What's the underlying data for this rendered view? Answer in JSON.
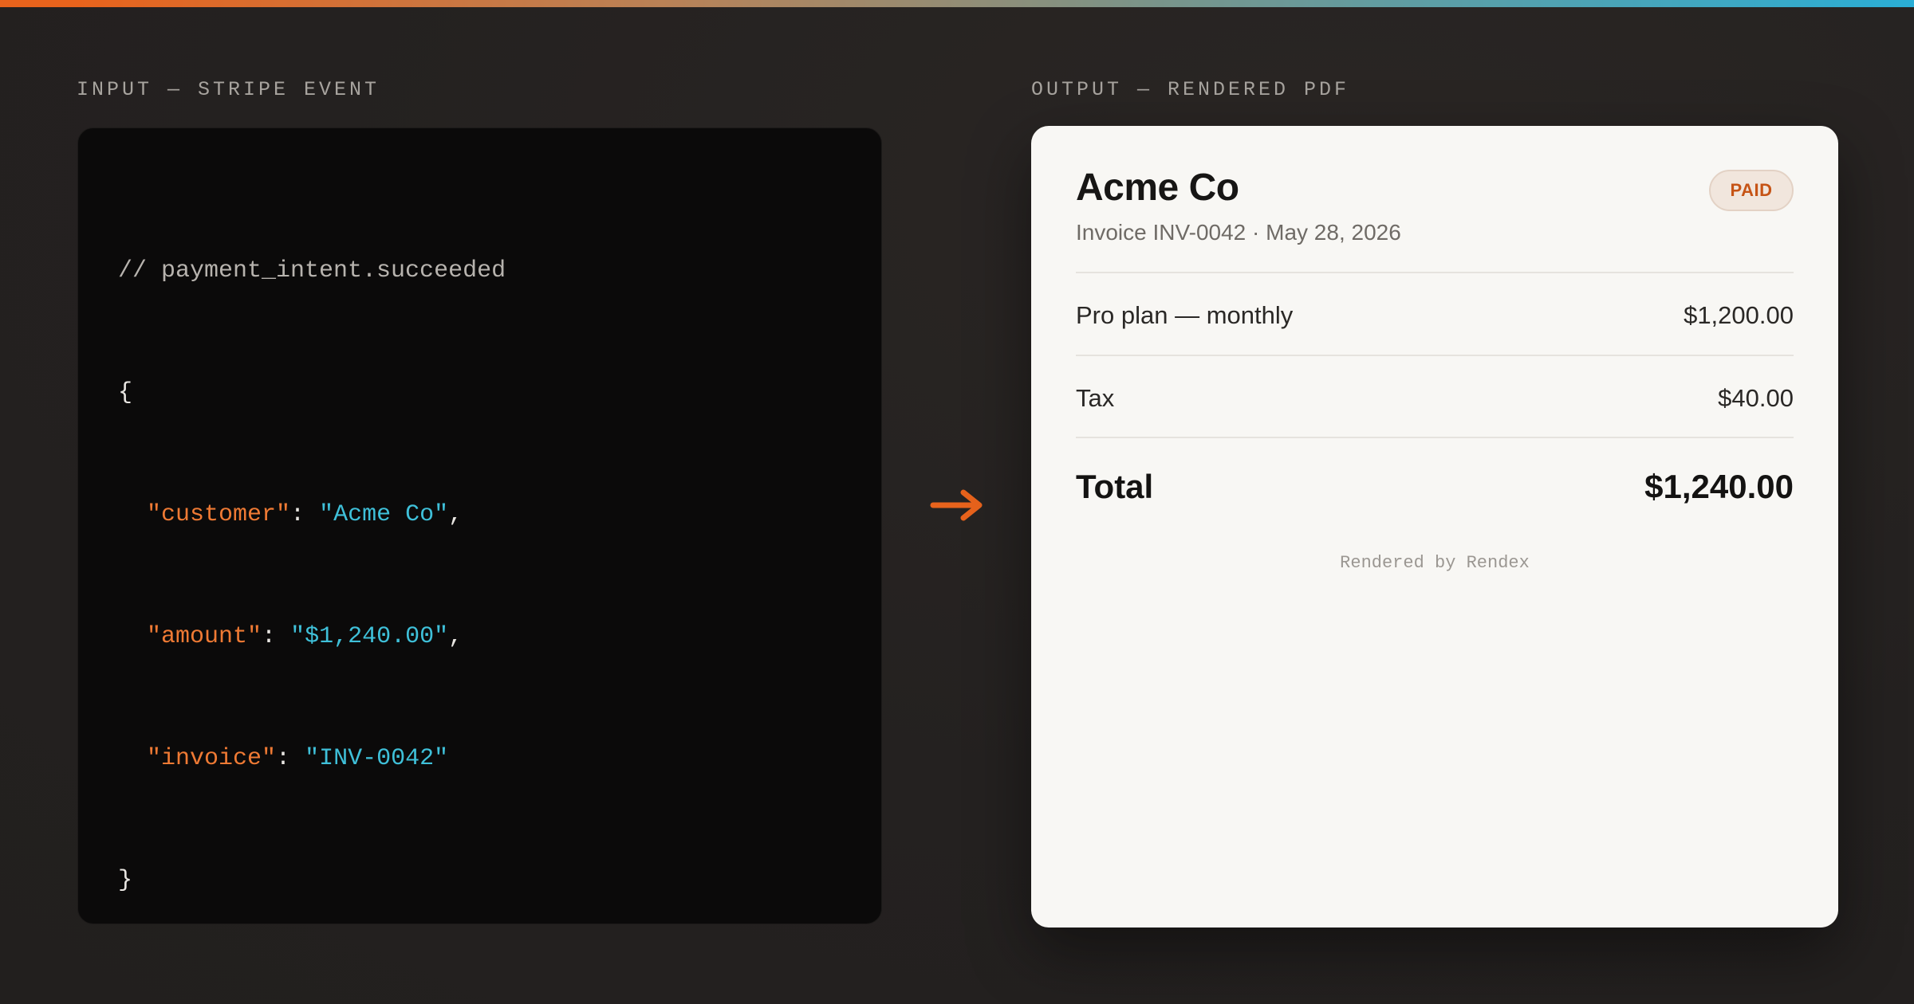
{
  "colors": {
    "accent": "#e8631c",
    "json_key": "#ef7a34",
    "json_value": "#3fc0d9",
    "paid_badge": "#c65416"
  },
  "labels": {
    "input": "INPUT — STRIPE EVENT",
    "output": "OUTPUT — RENDERED PDF"
  },
  "code": {
    "comment": "// payment_intent.succeeded",
    "open_brace": "{",
    "close_brace": "}",
    "fields": [
      {
        "key": "\"customer\"",
        "value": "\"Acme Co\"",
        "trail": ","
      },
      {
        "key": "\"amount\"",
        "value": "\"$1,240.00\"",
        "trail": ","
      },
      {
        "key": "\"invoice\"",
        "value": "\"INV-0042\"",
        "trail": ""
      }
    ],
    "colon": ": "
  },
  "arrow_icon": "right-arrow-icon",
  "invoice": {
    "company": "Acme Co",
    "subtitle": "Invoice INV-0042 · May 28, 2026",
    "status": "PAID",
    "lines": [
      {
        "label": "Pro plan — monthly",
        "amount": "$1,200.00"
      },
      {
        "label": "Tax",
        "amount": "$40.00"
      }
    ],
    "total_label": "Total",
    "total_amount": "$1,240.00",
    "footer": "Rendered by Rendex"
  }
}
